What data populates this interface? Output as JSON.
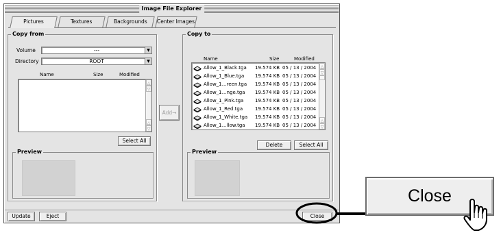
{
  "window": {
    "title": "Image File Explorer"
  },
  "tabs": [
    "Pictures",
    "Textures",
    "Backgrounds",
    "Center Images"
  ],
  "copy_from": {
    "legend": "Copy from",
    "volume_label": "Volume",
    "volume_value": "---",
    "directory_label": "Directory",
    "directory_value": "ROOT",
    "columns": {
      "name": "Name",
      "size": "Size",
      "modified": "Modified"
    },
    "select_all_label": "Select All",
    "preview_legend": "Preview"
  },
  "add_button_label": "Add→",
  "copy_to": {
    "legend": "Copy to",
    "columns": {
      "name": "Name",
      "size": "Size",
      "modified": "Modified"
    },
    "files": [
      {
        "name": "Allow_1_Black.tga",
        "size": "19.574 KB",
        "modified": "05 / 13 / 2004"
      },
      {
        "name": "Allow_1_Blue.tga",
        "size": "19.574 KB",
        "modified": "05 / 13 / 2004"
      },
      {
        "name": "Allow_1…reen.tga",
        "size": "19.574 KB",
        "modified": "05 / 13 / 2004"
      },
      {
        "name": "Allow_1…nge.tga",
        "size": "19.574 KB",
        "modified": "05 / 13 / 2004"
      },
      {
        "name": "Allow_1_Pink.tga",
        "size": "19.574 KB",
        "modified": "05 / 13 / 2004"
      },
      {
        "name": "Allow_1_Red.tga",
        "size": "19.574 KB",
        "modified": "05 / 13 / 2004"
      },
      {
        "name": "Allow_1_White.tga",
        "size": "19.574 KB",
        "modified": "05 / 13 / 2004"
      },
      {
        "name": "Allow_1…llow.tga",
        "size": "19.574 KB",
        "modified": "05 / 13 / 2004"
      }
    ],
    "delete_label": "Delete",
    "select_all_label": "Select All",
    "preview_legend": "Preview"
  },
  "footer": {
    "update_label": "Update",
    "eject_label": "Eject",
    "close_label": "Close"
  },
  "callout": {
    "close_label": "Close"
  },
  "icons": {
    "file": "file-icon",
    "combo": "dropdown-arrow-icon",
    "scroll_up": "scroll-up-icon",
    "scroll_down": "scroll-down-icon",
    "hand": "pointing-hand-icon"
  }
}
